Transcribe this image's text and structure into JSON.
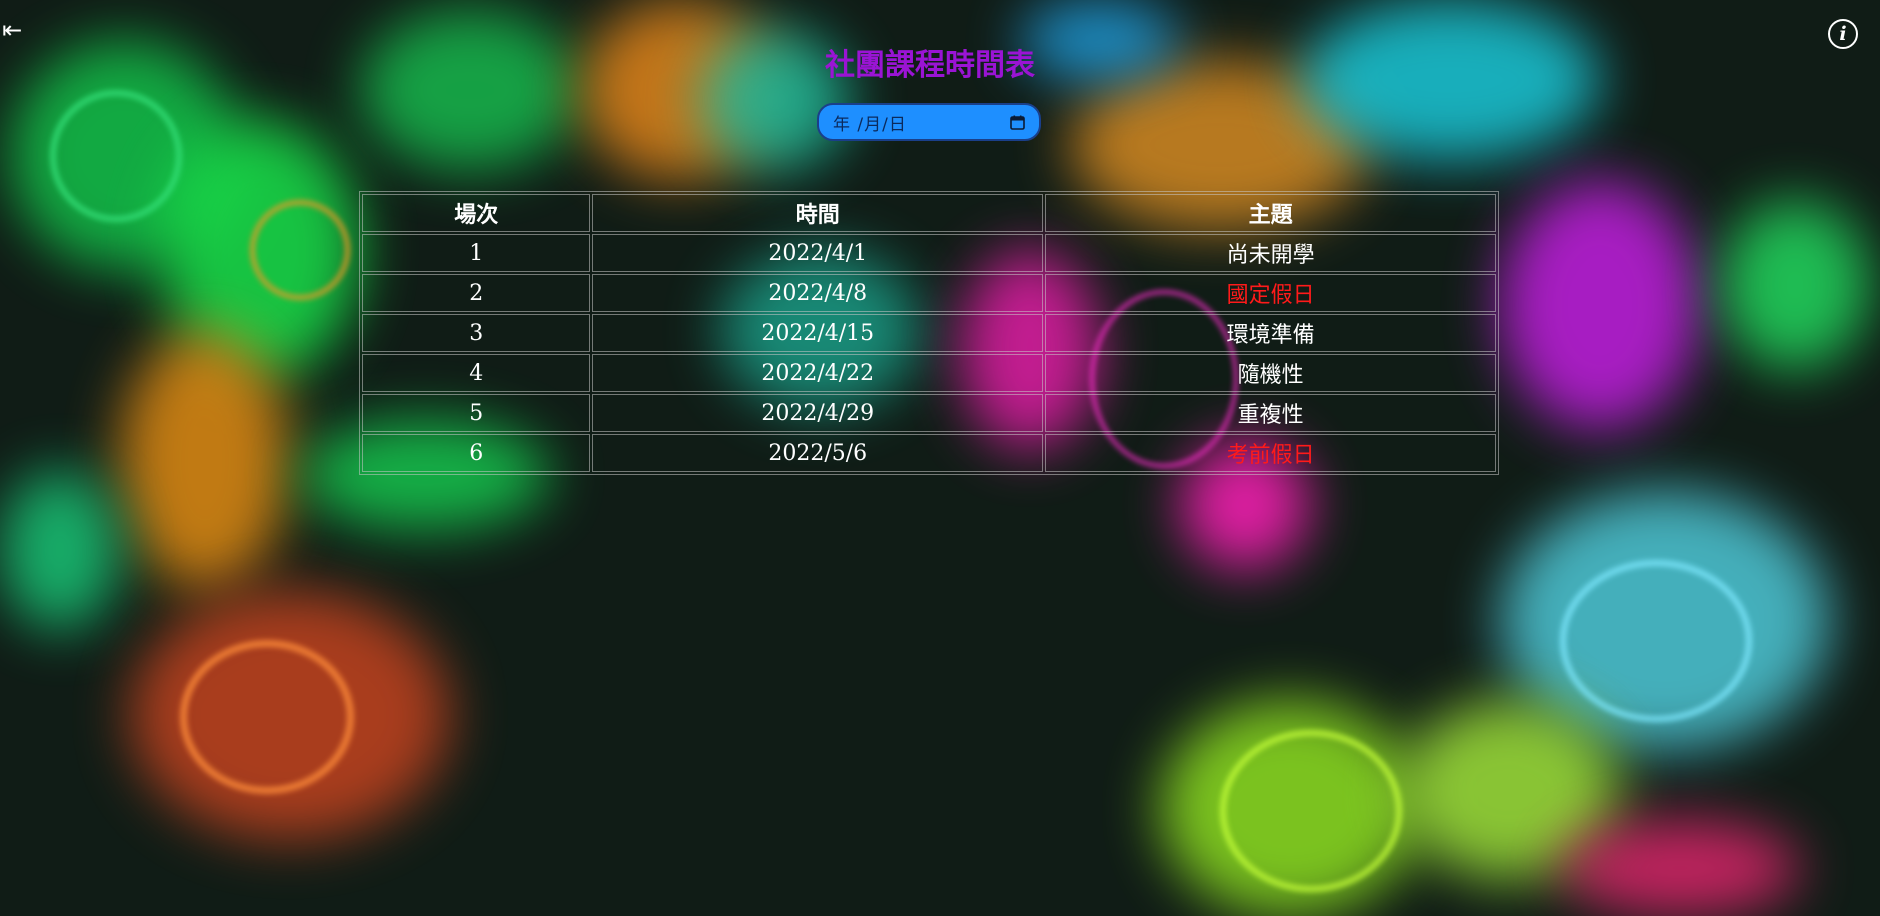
{
  "nav": {
    "back_label": "⇤",
    "info_label": "i"
  },
  "page_title": "社團課程時間表",
  "date_picker": {
    "display_value": "年  /月/日"
  },
  "table": {
    "headers": [
      "場次",
      "時間",
      "主題"
    ],
    "rows": [
      {
        "session": "1",
        "date": "2022/4/1",
        "topic": "尚未開學",
        "holiday": false
      },
      {
        "session": "2",
        "date": "2022/4/8",
        "topic": "國定假日",
        "holiday": true
      },
      {
        "session": "3",
        "date": "2022/4/15",
        "topic": "環境準備",
        "holiday": false
      },
      {
        "session": "4",
        "date": "2022/4/22",
        "topic": "隨機性",
        "holiday": false
      },
      {
        "session": "5",
        "date": "2022/4/29",
        "topic": "重複性",
        "holiday": false
      },
      {
        "session": "6",
        "date": "2022/5/6",
        "topic": "考前假日",
        "holiday": true
      }
    ]
  },
  "colors": {
    "title": "#9a14d4",
    "date_picker_bg": "#1e8fff",
    "holiday_text": "#ff1a1a",
    "normal_text": "#ffffff"
  }
}
